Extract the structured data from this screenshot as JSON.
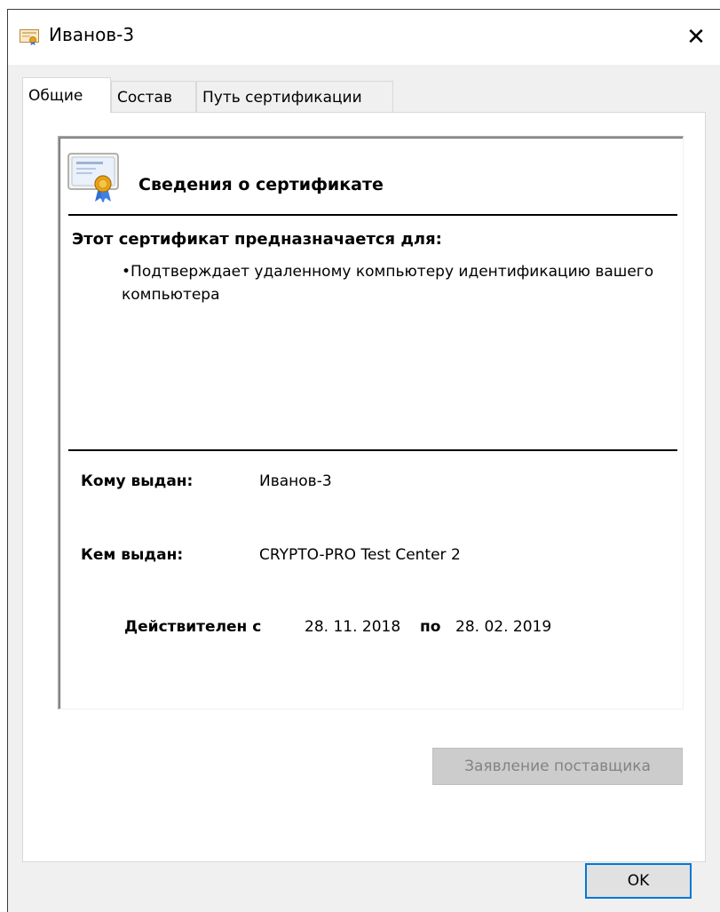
{
  "window": {
    "title": "Иванов-3",
    "close_glyph": "✕"
  },
  "tabs": [
    {
      "label": "Общие",
      "active": true
    },
    {
      "label": "Состав",
      "active": false
    },
    {
      "label": "Путь сертификации",
      "active": false
    }
  ],
  "certificate": {
    "heading": "Сведения о сертификате",
    "purpose_title": "Этот сертификат предназначается для:",
    "purposes": [
      "Подтверждает удаленному компьютеру идентификацию вашего компьютера"
    ],
    "issued_to_label": "Кому выдан:",
    "issued_to_value": "Иванов-3",
    "issued_by_label": "Кем выдан:",
    "issued_by_value": "CRYPTO-PRO Test Center 2",
    "valid_from_label": "Действителен с",
    "valid_from_value": "28. 11. 2018",
    "valid_to_label": "по",
    "valid_to_value": "28. 02. 2019"
  },
  "buttons": {
    "issuer_statement": "Заявление поставщика",
    "ok": "OK"
  },
  "icons": {
    "title_icon": "certificate-icon",
    "cert_icon": "certificate-ribbon-icon"
  },
  "colors": {
    "focus_border": "#0078d7",
    "disabled_text": "#838383",
    "dialog_bg": "#f0f0f0",
    "ribbon_gold": "#e8a317",
    "ribbon_blue": "#2f6fd6"
  }
}
